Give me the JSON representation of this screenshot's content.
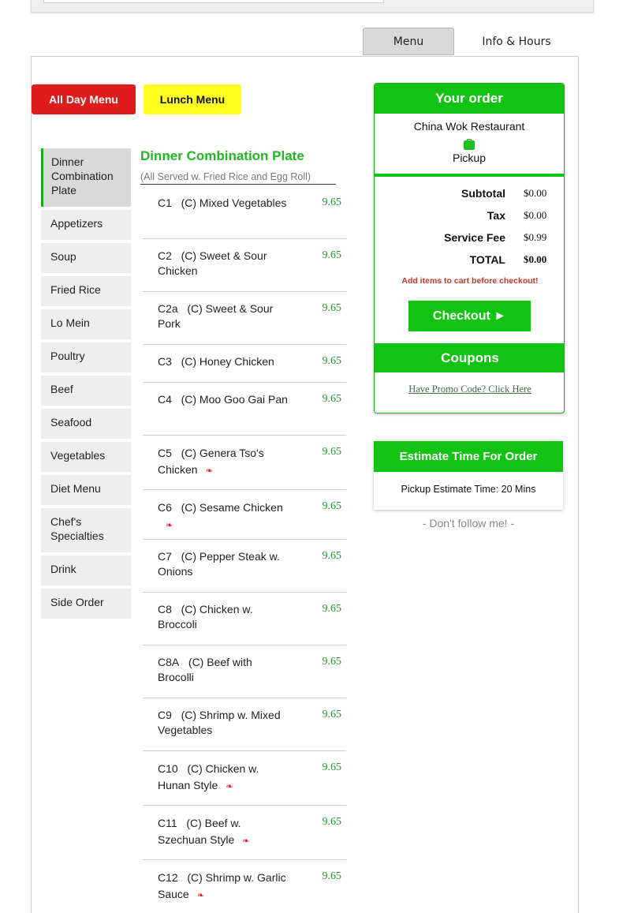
{
  "tabs": [
    {
      "label": "Menu",
      "active": true
    },
    {
      "label": "Info & Hours",
      "active": false
    }
  ],
  "menu_buttons": {
    "all_day": "All Day Menu",
    "lunch": "Lunch Menu"
  },
  "sidebar": {
    "items": [
      {
        "label": "Dinner Combination Plate",
        "active": true
      },
      {
        "label": "Appetizers"
      },
      {
        "label": "Soup"
      },
      {
        "label": "Fried Rice"
      },
      {
        "label": "Lo Mein"
      },
      {
        "label": "Poultry"
      },
      {
        "label": "Beef"
      },
      {
        "label": "Seafood"
      },
      {
        "label": "Vegetables"
      },
      {
        "label": "Diet Menu"
      },
      {
        "label": "Chef's Specialties"
      },
      {
        "label": "Drink"
      },
      {
        "label": "Side Order"
      }
    ]
  },
  "section": {
    "title": "Dinner Combination Plate",
    "subtitle": "(All Served w. Fried Rice and Egg Roll)"
  },
  "items": [
    {
      "code": "C1",
      "name": "(C) Mixed Vegetables",
      "price": "9.65",
      "spicy": false
    },
    {
      "code": "C2",
      "name": "(C) Sweet & Sour Chicken",
      "price": "9.65",
      "spicy": false
    },
    {
      "code": "C2a",
      "name": "(C) Sweet & Sour Pork",
      "price": "9.65",
      "spicy": false
    },
    {
      "code": "C3",
      "name": "(C) Honey Chicken",
      "price": "9.65",
      "spicy": false
    },
    {
      "code": "C4",
      "name": "(C) Moo Goo Gai Pan",
      "price": "9.65",
      "spicy": false
    },
    {
      "code": "C5",
      "name": "(C) Genera Tso's Chicken",
      "price": "9.65",
      "spicy": true
    },
    {
      "code": "C6",
      "name": "(C) Sesame Chicken",
      "price": "9.65",
      "spicy": true
    },
    {
      "code": "C7",
      "name": "(C) Pepper Steak w. Onions",
      "price": "9.65",
      "spicy": false
    },
    {
      "code": "C8",
      "name": "(C) Chicken w. Broccoli",
      "price": "9.65",
      "spicy": false
    },
    {
      "code": "C8A",
      "name": "(C) Beef with Brocolli",
      "price": "9.65",
      "spicy": false
    },
    {
      "code": "C9",
      "name": "(C) Shrimp w. Mixed Vegetables",
      "price": "9.65",
      "spicy": false
    },
    {
      "code": "C10",
      "name": "(C) Chicken w. Hunan Style",
      "price": "9.65",
      "spicy": true
    },
    {
      "code": "C11",
      "name": "(C) Beef w. Szechuan Style",
      "price": "9.65",
      "spicy": true
    },
    {
      "code": "C12",
      "name": "(C) Shrimp w. Garlic Sauce",
      "price": "9.65",
      "spicy": true
    }
  ],
  "order": {
    "title": "Your order",
    "restaurant": "China Wok Restaurant",
    "mode": "Pickup",
    "subtotal_label": "Subtotal",
    "subtotal": "$0.00",
    "tax_label": "Tax",
    "tax": "$0.00",
    "service_fee_label": "Service Fee",
    "service_fee": "$0.99",
    "total_label": "TOTAL",
    "total": "$0.00",
    "warning": "Add items to cart before checkout!",
    "checkout_label": "Checkout ►",
    "coupons_title": "Coupons",
    "promo_link": "Have Promo Code? Click Here"
  },
  "estimate": {
    "title": "Estimate Time For Order",
    "text": "Pickup Estimate Time: 20 Mins"
  },
  "footer_note": "- Don't follow me! -",
  "colors": {
    "brand_green": "#13c313",
    "all_day_red": "#e01b1b",
    "lunch_yellow": "#ffff1f",
    "price_green": "#22992a",
    "warning_red": "#c0392b"
  },
  "icons": {
    "pickup": "shopping-bag-icon",
    "spicy": "chili-pepper-icon"
  }
}
